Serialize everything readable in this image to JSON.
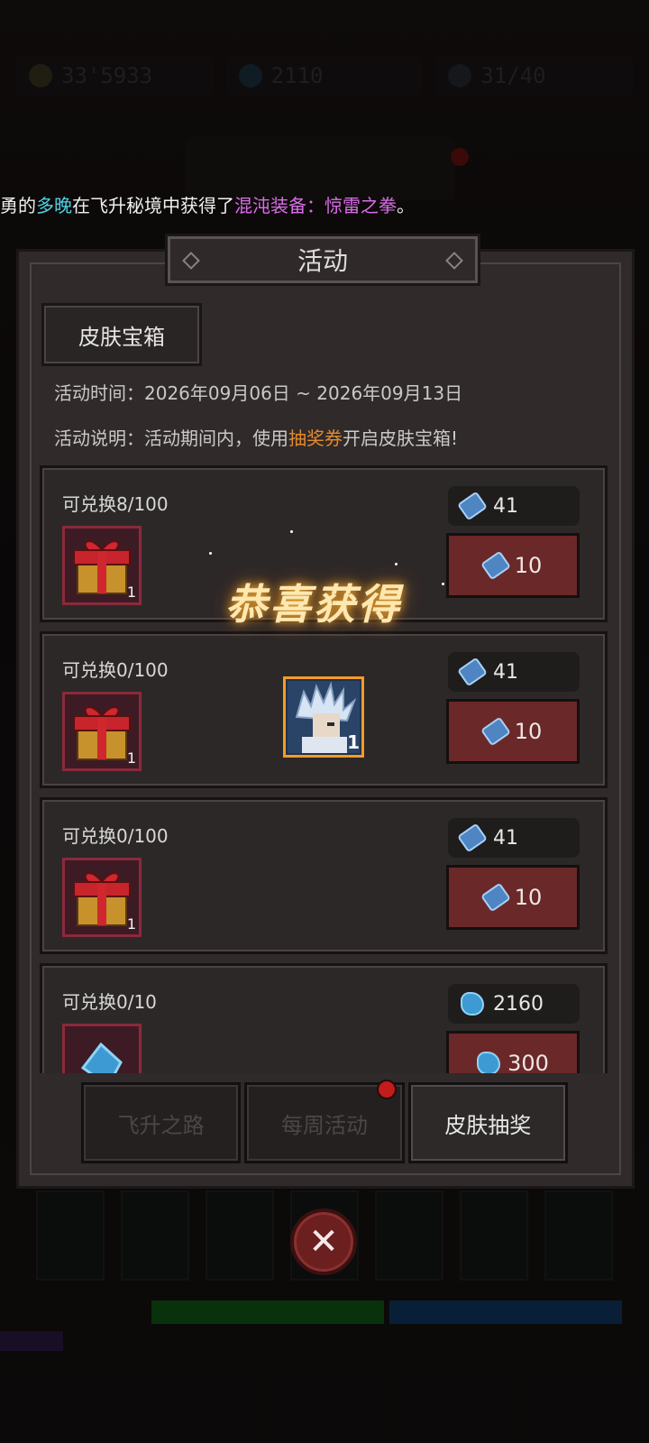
{
  "background": {
    "resources": [
      {
        "icon": "gold-coin-icon",
        "value": "33'5933"
      },
      {
        "icon": "blue-gem-icon",
        "value": "2110"
      },
      {
        "icon": "feather-icon",
        "value": "31/40"
      }
    ]
  },
  "ticker": {
    "prefix": "勇的",
    "name": "多晚",
    "middle": "在飞升秘境中获得了",
    "item": "混沌装备：惊雷之拳",
    "suffix": "。"
  },
  "panel": {
    "title": "活动",
    "tab_label": "皮肤宝箱",
    "time_label": "活动时间：2026年09月06日 ~ 2026年09月13日",
    "desc_prefix": "活动说明：活动期间内，使用",
    "desc_highlight": "抽奖券",
    "desc_suffix": "开启皮肤宝箱!"
  },
  "cards": [
    {
      "label": "可兑换8/100",
      "gift_qty": "1",
      "cost": "41",
      "price": "10"
    },
    {
      "label": "可兑换0/100",
      "gift_qty": "1",
      "cost": "41",
      "price": "10"
    },
    {
      "label": "可兑换0/100",
      "gift_qty": "1",
      "cost": "41",
      "price": "10"
    },
    {
      "label": "可兑换0/10",
      "gift_qty": "",
      "cost": "2160",
      "price": "300"
    }
  ],
  "bottom_tabs": [
    {
      "label": "飞升之路",
      "active": false
    },
    {
      "label": "每周活动",
      "active": false,
      "badge": true
    },
    {
      "label": "皮肤抽奖",
      "active": true
    }
  ],
  "reward": {
    "title": "恭喜获得",
    "qty": "1"
  },
  "colors": {
    "accent_orange": "#e48a2c",
    "name_cyan": "#4fd1e6",
    "item_purple": "#d76ee6",
    "button_red": "#6b2828"
  }
}
